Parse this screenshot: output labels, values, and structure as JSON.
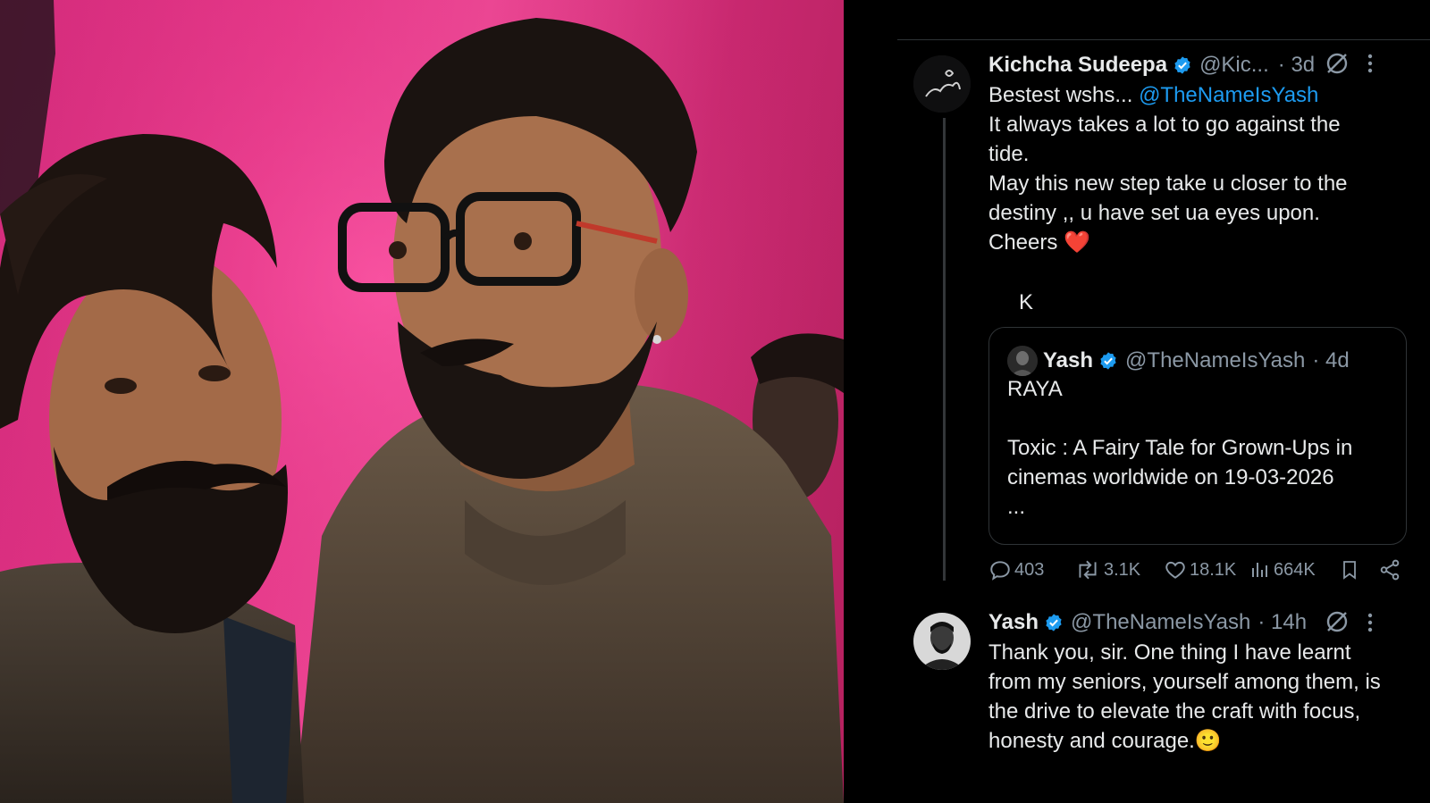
{
  "tweet1": {
    "name": "Kichcha Sudeepa",
    "handle": "@Kic...",
    "time": "· 3d",
    "text_prefix": "Bestest wshs... ",
    "mention": "@TheNameIsYash",
    "text_rest": "It always takes a lot to go against the\ntide.\nMay this new step take u closer to the\ndestiny ,, u have set ua eyes upon.\nCheers ",
    "heart_emoji": "❤️",
    "signature": "K"
  },
  "quoted": {
    "name": "Yash",
    "handle": "@TheNameIsYash",
    "time": "· 4d",
    "text": "RAYA\n\nToxic : A Fairy Tale for Grown-Ups in\ncinemas worldwide on 19-03-2026\n..."
  },
  "actions": {
    "replies": "403",
    "reposts": "3.1K",
    "likes": "18.1K",
    "views": "664K"
  },
  "tweet2": {
    "name": "Yash",
    "handle": "@TheNameIsYash",
    "time": "· 14h",
    "text": "Thank you, sir.  One thing I have learnt\nfrom my seniors, yourself among them, is\nthe drive to elevate the craft with focus,\nhonesty and courage.",
    "emoji": "🙂"
  },
  "icons": {
    "verified": "verified-badge-icon",
    "grok": "grok-icon",
    "more": "more-icon",
    "reply": "reply-icon",
    "repost": "repost-icon",
    "like": "heart-icon",
    "views": "views-icon",
    "bookmark": "bookmark-icon",
    "share": "share-icon"
  },
  "colors": {
    "background": "#000000",
    "text": "#e7e9ea",
    "secondary": "#8b98a5",
    "accent": "#1d9bf0",
    "border": "#2f3336",
    "photo_bg": "#e8378a"
  }
}
